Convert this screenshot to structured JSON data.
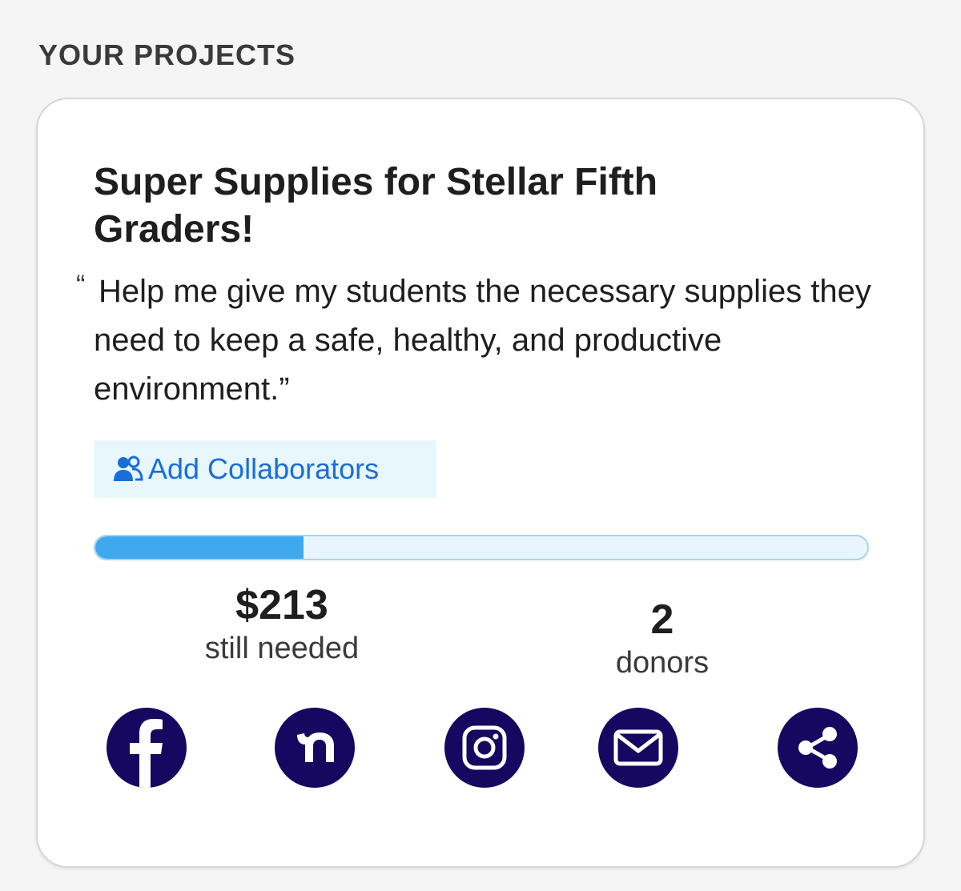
{
  "section": {
    "heading": "YOUR PROJECTS"
  },
  "project": {
    "title": "Super Supplies for Stellar Fifth Graders!",
    "quote_open": "“",
    "quote": "Help me give my students the necessary supplies they need to keep a safe, healthy, and productive environment.”",
    "collaborators_button": {
      "label": "Add Collaborators",
      "icon": "users-icon"
    },
    "progress": {
      "funded_fraction": 0.27
    },
    "stats": {
      "still_needed": {
        "value": "$213",
        "label": "still needed"
      },
      "donors": {
        "value": "2",
        "label": "donors"
      }
    },
    "share_buttons": [
      {
        "name": "facebook",
        "icon": "facebook-icon"
      },
      {
        "name": "nextdoor",
        "icon": "nextdoor-icon"
      },
      {
        "name": "instagram",
        "icon": "instagram-icon"
      },
      {
        "name": "email",
        "icon": "mail-icon"
      },
      {
        "name": "share",
        "icon": "share-icon"
      }
    ]
  },
  "colors": {
    "accent_link": "#1a6ed8",
    "progress_fill": "#3fa9ef",
    "share_icon_bg": "#160860",
    "collab_bg": "#e8f7fc"
  }
}
